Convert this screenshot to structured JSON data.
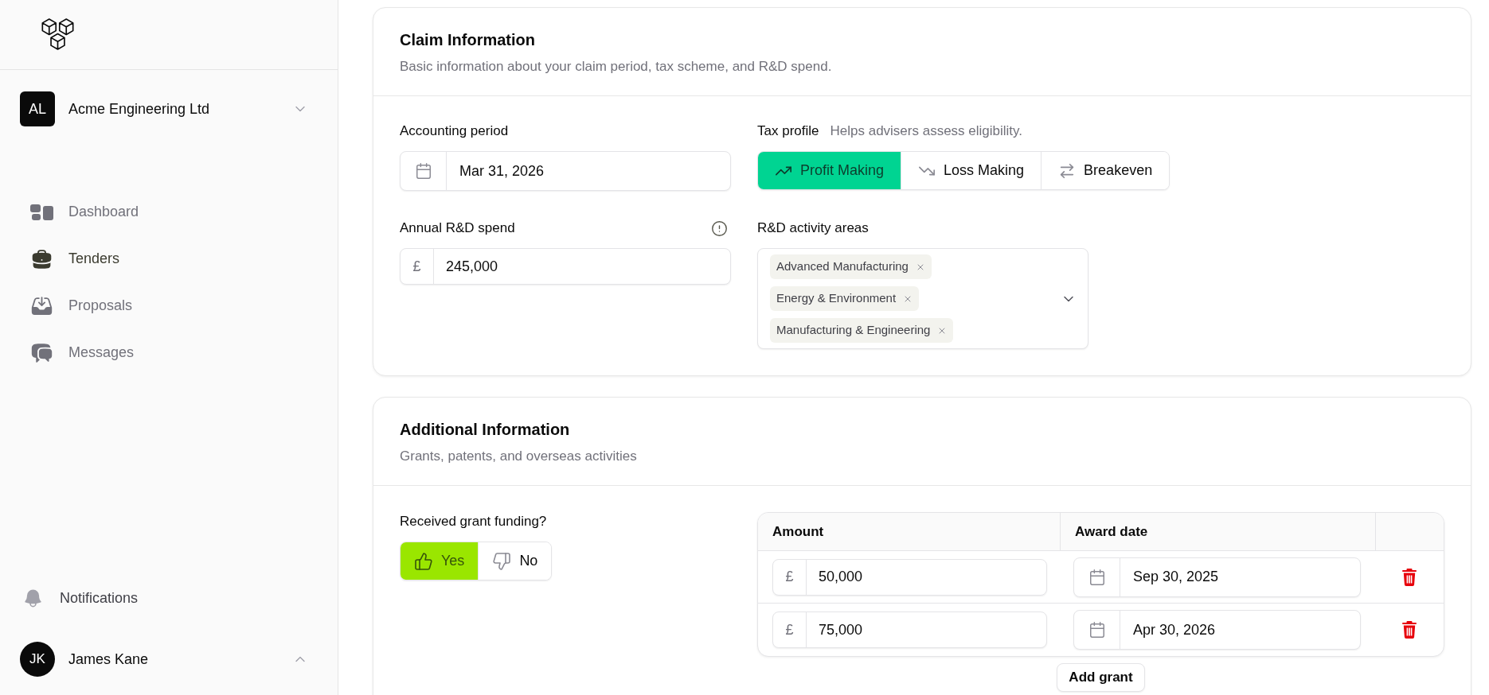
{
  "sidebar": {
    "organization": {
      "initials": "AL",
      "name": "Acme Engineering Ltd"
    },
    "nav": [
      {
        "label": "Dashboard",
        "selected": false
      },
      {
        "label": "Tenders",
        "selected": true
      },
      {
        "label": "Proposals",
        "selected": false
      },
      {
        "label": "Messages",
        "selected": false
      }
    ],
    "notifications": {
      "label": "Notifications"
    },
    "user": {
      "initials": "JK",
      "name": "James Kane"
    }
  },
  "claim_information": {
    "title": "Claim Information",
    "subtitle": "Basic information about your claim period, tax scheme, and R&D spend.",
    "accounting_period": {
      "label": "Accounting period",
      "value": "Mar 31, 2026"
    },
    "tax_profile": {
      "label": "Tax profile",
      "hint": "Helps advisers assess eligibility.",
      "options": [
        {
          "label": "Profit Making",
          "selected": true
        },
        {
          "label": "Loss Making",
          "selected": false
        },
        {
          "label": "Breakeven",
          "selected": false
        }
      ]
    },
    "annual_rd_spend": {
      "label": "Annual R&D spend",
      "currency": "£",
      "value": "245,000"
    },
    "activity_areas": {
      "label": "R&D activity areas",
      "tags": [
        "Advanced Manufacturing",
        "Energy & Environment",
        "Manufacturing & Engineering"
      ]
    }
  },
  "additional_information": {
    "title": "Additional Information",
    "subtitle": "Grants, patents, and overseas activities",
    "grant_funding": {
      "label": "Received grant funding?",
      "options": [
        {
          "label": "Yes",
          "selected": true
        },
        {
          "label": "No",
          "selected": false
        }
      ]
    },
    "grants": {
      "columns": [
        "Amount",
        "Award date"
      ],
      "rows": [
        {
          "currency": "£",
          "amount": "50,000",
          "award_date": "Sep 30, 2025"
        },
        {
          "currency": "£",
          "amount": "75,000",
          "award_date": "Apr 30, 2026"
        }
      ]
    },
    "add_button": "Add grant"
  }
}
